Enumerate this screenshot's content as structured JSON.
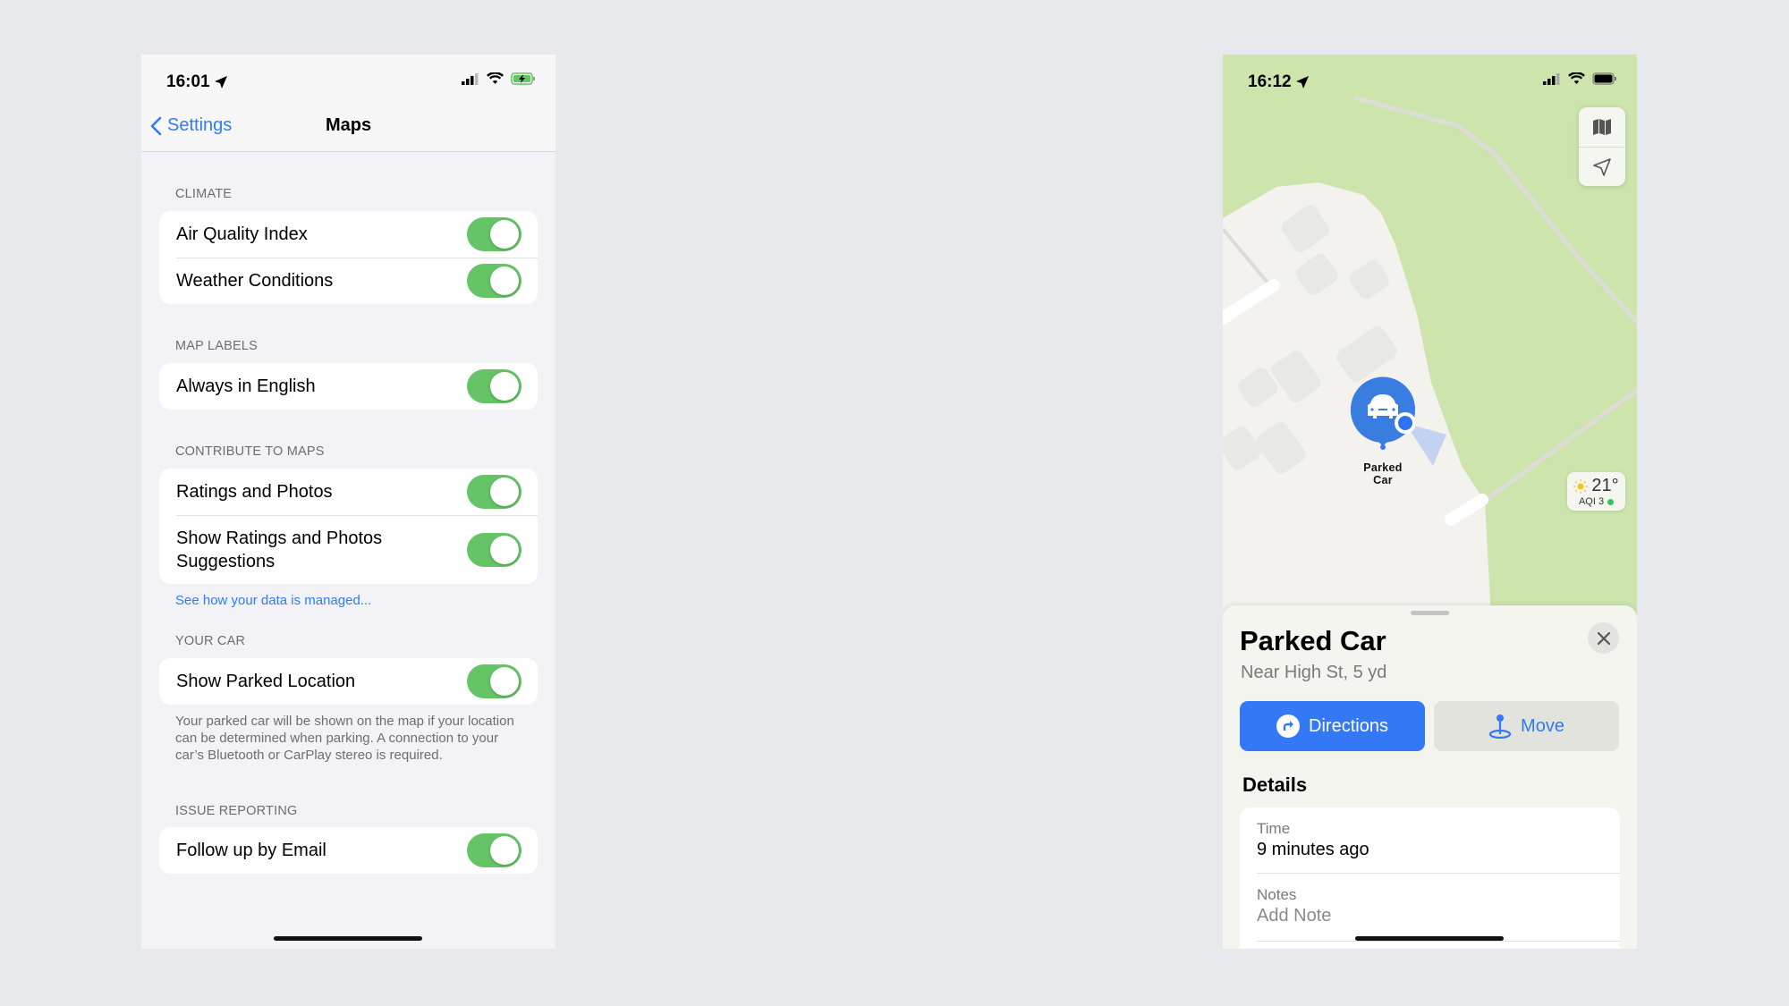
{
  "settings_screen": {
    "status": {
      "time": "16:01",
      "location_icon": "location-arrow-icon",
      "signal": "signal-icon",
      "wifi": "wifi-icon",
      "battery": "battery-charging-icon"
    },
    "nav": {
      "back_label": "Settings",
      "title": "Maps"
    },
    "sections": [
      {
        "header": "CLIMATE",
        "rows": [
          {
            "label": "Air Quality Index",
            "on": true
          },
          {
            "label": "Weather Conditions",
            "on": true
          }
        ]
      },
      {
        "header": "MAP LABELS",
        "rows": [
          {
            "label": "Always in English",
            "on": true
          }
        ]
      },
      {
        "header": "CONTRIBUTE TO MAPS",
        "rows": [
          {
            "label": "Ratings and Photos",
            "on": true
          },
          {
            "label": "Show Ratings and Photos Suggestions",
            "on": true
          }
        ],
        "link": "See how your data is managed..."
      },
      {
        "header": "YOUR CAR",
        "rows": [
          {
            "label": "Show Parked Location",
            "on": true
          }
        ],
        "footer": "Your parked car will be shown on the map if your location can be determined when parking. A connection to your car’s Bluetooth or CarPlay stereo is required."
      },
      {
        "header": "ISSUE REPORTING",
        "rows": [
          {
            "label": "Follow up by Email",
            "on": true
          }
        ]
      }
    ],
    "toggle_color": "#65c466",
    "accent": "#2f7bf6"
  },
  "maps_screen": {
    "status": {
      "time": "16:12"
    },
    "map": {
      "pin_label": "Parked Car",
      "weather": {
        "temp": "21°",
        "aqi": "AQI 3",
        "aqi_color": "#34c759"
      },
      "controls": [
        "map-mode-icon",
        "location-arrow-icon"
      ]
    },
    "sheet": {
      "title": "Parked Car",
      "subtitle": "Near High St, 5 yd",
      "directions_label": "Directions",
      "move_label": "Move",
      "details_header": "Details",
      "details": [
        {
          "label": "Time",
          "value": "9 minutes ago"
        },
        {
          "label": "Notes",
          "value": "Add Note"
        }
      ]
    },
    "accent": "#3478f6"
  }
}
